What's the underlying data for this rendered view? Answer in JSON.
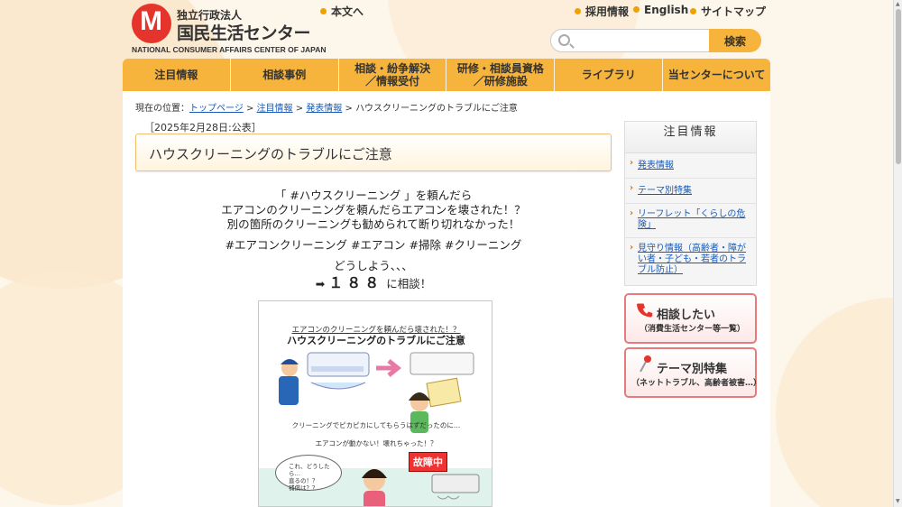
{
  "header": {
    "logo_sub": "独立行政法人",
    "logo_main": "国民生活センター",
    "logo_en": "NATIONAL CONSUMER AFFAIRS CENTER OF JAPAN",
    "skip_link": "本文へ",
    "top_links": [
      "採用情報",
      "English",
      "サイトマップ"
    ],
    "search_placeholder": "",
    "search_button": "検索"
  },
  "nav": {
    "items": [
      "注目情報",
      "相談事例",
      "相談・紛争解決／情報受付",
      "研修・相談員資格／研修施設",
      "ライブラリ",
      "当センターについて"
    ]
  },
  "breadcrumb": {
    "prefix": "現在の位置：",
    "items": [
      "トップページ",
      "注目情報",
      "発表情報"
    ],
    "current": "ハウスクリーニングのトラブルにご注意"
  },
  "article": {
    "date": "［2025年2月28日:公表］",
    "title": "ハウスクリーニングのトラブルにご注意",
    "lead1": "「 #ハウスクリーニング 」を頼んだら",
    "lead2": "エアコンのクリーニングを頼んだらエアコンを壊された！？",
    "lead3": "別の箇所のクリーニングも勧められて断り切れなかった！",
    "hashtags": "#エアコンクリーニング #エアコン #掃除 #クリーニング",
    "lead4": "どうしよう、、、",
    "arrow": "➡",
    "hotline_number": "１８８",
    "hotline_suffix": "に相談！"
  },
  "illustration": {
    "caption1": "エアコンのクリーニングを頼んだら壊された！？",
    "caption2": "ハウスクリーニングのトラブルにご注意",
    "text1": "クリーニングでピカピカにしてもらうはずだったのに…",
    "text2": "エアコンが動かない！壊れちゃった！？",
    "bubble": "これ、どうしたら…\n直るの！？\n補償は？？",
    "fault_sign": "故障中"
  },
  "sidebar": {
    "title": "注目情報",
    "links": [
      "発表情報",
      "テーマ別特集",
      "リーフレット「くらしの危険」",
      "見守り情報（高齢者・障がい者・子ども・若者のトラブル防止）"
    ],
    "consult_label": "相談したい",
    "consult_sub": "（消費生活センター等一覧）",
    "theme_label": "テーマ別特集",
    "theme_sub": "（ネットトラブル、高齢者被害…）"
  },
  "colors": {
    "accent": "#f6b43c",
    "brand_red": "#e5342b",
    "link": "#1a5bb8"
  }
}
